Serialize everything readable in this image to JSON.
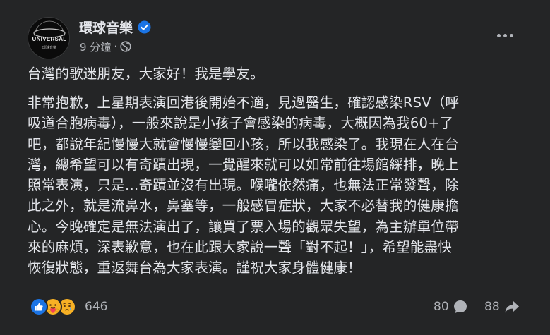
{
  "post": {
    "author": "環球音樂",
    "time": "9 分鐘",
    "separator": "·",
    "greeting": "台灣的歌迷朋友，大家好！我是學友。",
    "body_lines": [
      "非常抱歉，上星期表演回港後開始不適，見過醫生，確認感染RSV（呼",
      "吸道合胞病毒），一般來說是小孩子會感染的病毒，大概因為我60+了",
      "吧，都說年紀慢慢大就會慢慢變回小孩，所以我感染了。我現在人在台",
      "灣，總希望可以有奇蹟出現，一覺醒來就可以如常前往場館綵排，晚上",
      "照常表演，只是…奇蹟並沒有出現。喉嚨依然痛，也無法正常發聲，除",
      "此之外，就是流鼻水，鼻塞等，一般感冒症狀，大家不必替我的健康擔",
      "心。今晚確定是無法演出了，讓買了票入場的觀眾失望，為主辦單位帶",
      "來的麻煩，深表歉意，也在此跟大家說一聲「對不起！」，希望能盡快",
      "恢復狀態，重返舞台為大家表演。謹祝大家身體健康！"
    ],
    "avatar_logo": "UNIVERSAL",
    "avatar_sub": "環球音樂"
  },
  "footer": {
    "reaction_count": "646",
    "comment_count": "80",
    "share_count": "88",
    "reaction_icons": [
      "like-icon",
      "care-icon",
      "sad-icon"
    ]
  },
  "colors": {
    "background": "#242526",
    "primary_text": "#e4e6eb",
    "secondary_text": "#b0b3b8",
    "like_blue": "#1b74e4",
    "emoji_yellow": "#f7b125"
  }
}
